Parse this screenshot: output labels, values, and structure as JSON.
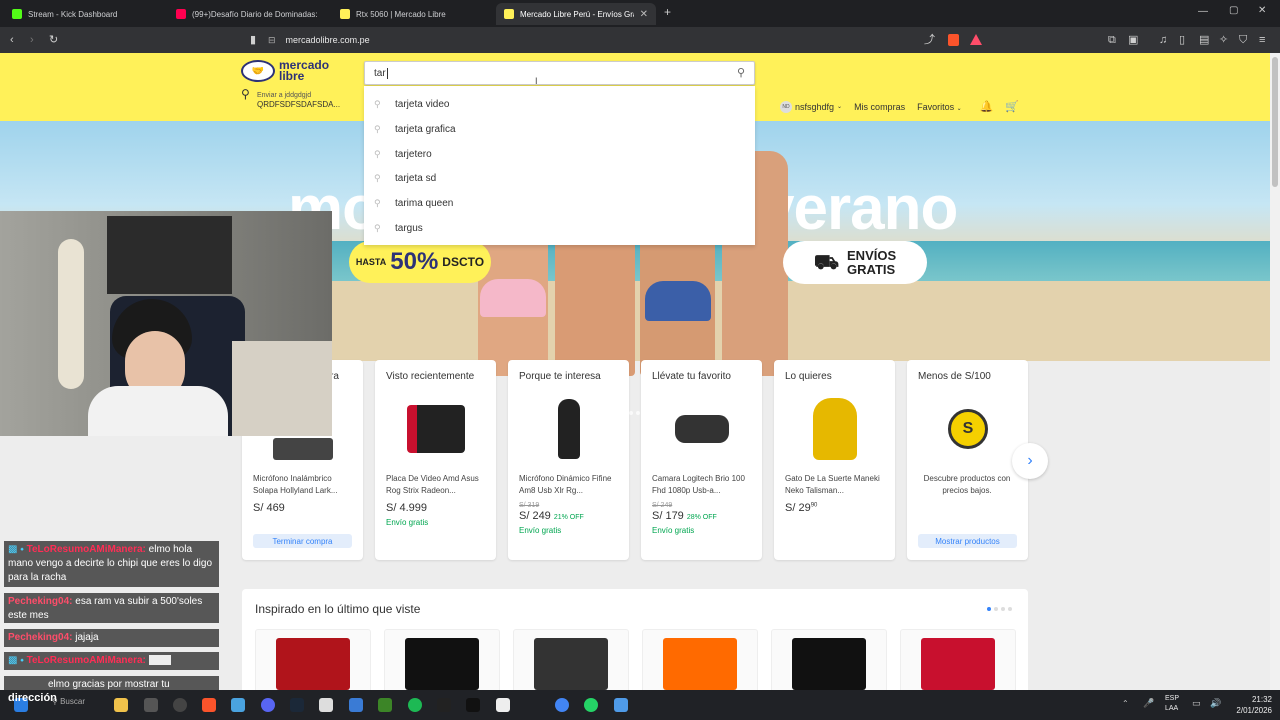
{
  "browser": {
    "tabs": [
      {
        "label": "Stream - Kick Dashboard",
        "color": "#53fc18"
      },
      {
        "label": "(99+)Desafío Diario de Dominadas: D",
        "color": "#ff0050"
      },
      {
        "label": "Rtx 5060 | Mercado Libre",
        "color": "#fff159"
      },
      {
        "label": "Mercado Libre Perú - Envíos Grá",
        "color": "#fff159"
      }
    ],
    "url": "mercadolibre.com.pe"
  },
  "header": {
    "logo_line1": "mercado",
    "logo_line2": "libre",
    "address_label": "Enviar a jddgdgjd",
    "address_value": "QRDFSDFSDAFSDA...",
    "search_value": "tar",
    "suggestions": [
      "tarjeta video",
      "tarjeta grafica",
      "tarjetero",
      "tarjeta sd",
      "tarima queen",
      "targus"
    ],
    "user_initials": "ND",
    "user_name": "nsfsghdfg",
    "my_purchases": "Mis compras",
    "favorites": "Favoritos"
  },
  "hero": {
    "title_left": "mo",
    "title_right": "verano",
    "promo_prefix": "HASTA",
    "promo_value": "50%",
    "promo_suffix": "DSCTO",
    "shipping_line1": "ENVÍOS",
    "shipping_line2": "GRATIS"
  },
  "cards": [
    {
      "heading": "ra",
      "name": "Micrófono Inalámbrico Solapa Hollyland Lark...",
      "old": "",
      "price": "S/ 469",
      "discount": "",
      "shipping": "",
      "button": "Terminar compra",
      "color": "#444"
    },
    {
      "heading": "Visto recientemente",
      "name": "Placa De Video Amd Asus Rog Strix Radeon...",
      "old": "",
      "price": "S/ 4.999",
      "discount": "",
      "shipping": "Envío gratis",
      "button": "",
      "color": "#c8102e"
    },
    {
      "heading": "Porque te interesa",
      "name": "Micrófono Dinámico Fifine Am8 Usb Xlr Rg...",
      "old": "S/ 319",
      "price": "S/ 249",
      "discount": "21% OFF",
      "shipping": "Envío gratis",
      "button": "",
      "color": "#222"
    },
    {
      "heading": "Llévate tu favorito",
      "name": "Camara Logitech Brio 100 Fhd 1080p Usb-a...",
      "old": "S/ 249",
      "price": "S/ 179",
      "discount": "28% OFF",
      "shipping": "Envío gratis",
      "button": "",
      "color": "#333"
    },
    {
      "heading": "Lo quieres",
      "name": "Gato De La Suerte Maneki Neko Talisman...",
      "old": "",
      "price": "S/ 29",
      "price_cents": "90",
      "discount": "",
      "shipping": "",
      "button": "",
      "color": "#e6b800"
    },
    {
      "heading": "Menos de S/100",
      "name": "Descubre productos con precios bajos.",
      "old": "",
      "price": "",
      "discount": "",
      "shipping": "",
      "button": "Mostrar productos",
      "color": "#f5d000"
    }
  ],
  "inspired": {
    "title": "Inspirado en lo último que viste",
    "thumb_colors": [
      "#b0141b",
      "#111111",
      "#333333",
      "#ff6a00",
      "#111111",
      "#c8102e"
    ]
  },
  "chat": [
    {
      "user": "TeLoResumoAMiManera:",
      "text": "elmo hola mano vengo a decirte lo chipi que eres lo digo para la racha"
    },
    {
      "user": "Pecheking04:",
      "text": "esa ram va subir a 500'soles este mes"
    },
    {
      "user": "Pecheking04:",
      "text": "jajaja"
    },
    {
      "user": "TeLoResumoAMiManera:",
      "text": ""
    },
    {
      "user": "",
      "text": "elmo gracias por mostrar tu"
    }
  ],
  "overlay_text": "dirección",
  "taskbar": {
    "search_placeholder": "Buscar",
    "lang1": "ESP",
    "lang2": "LAA",
    "time": "21:32",
    "date": "2/01/2026"
  }
}
